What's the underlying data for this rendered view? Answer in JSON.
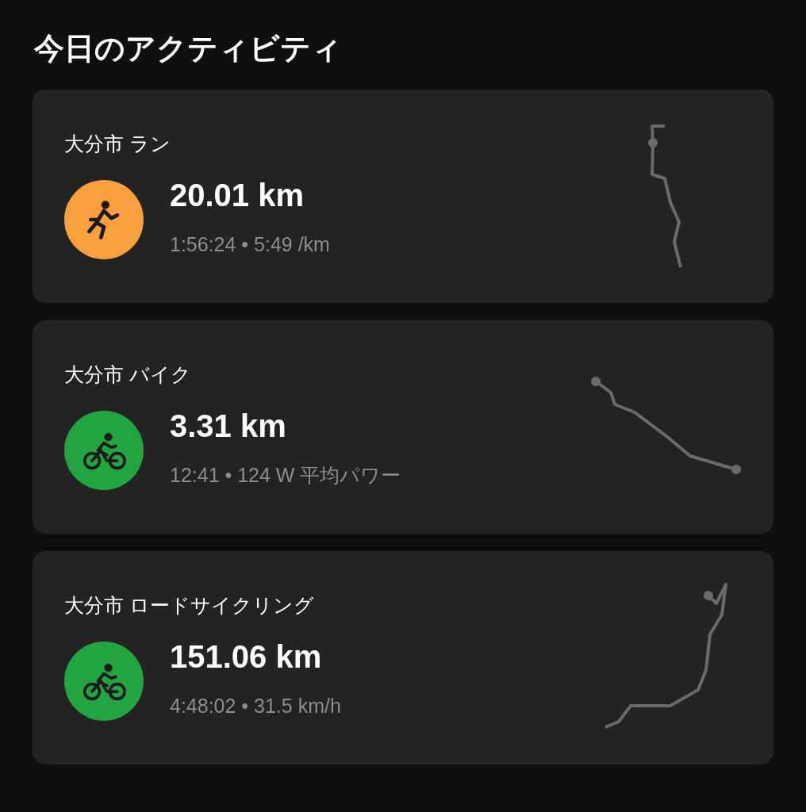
{
  "title": "今日のアクティビティ",
  "activities": [
    {
      "label": "大分市 ラン",
      "kind": "run",
      "color": "#f8a03e",
      "distance": "20.01 km",
      "details": "1:56:24 • 5:49 /km"
    },
    {
      "label": "大分市 バイク",
      "kind": "bike",
      "color": "#22a541",
      "distance": "3.31 km",
      "details": "12:41 • 124 W 平均パワー"
    },
    {
      "label": "大分市 ロードサイクリング",
      "kind": "bike",
      "color": "#22a541",
      "distance": "151.06 km",
      "details": "4:48:02 • 31.5 km/h"
    }
  ]
}
